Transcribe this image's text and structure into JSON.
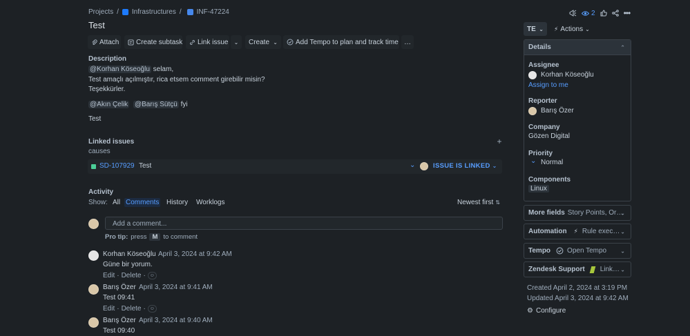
{
  "breadcrumb": {
    "projects": "Projects",
    "separator": "/",
    "project": "Infrastructures",
    "issue_key": "INF-47224"
  },
  "issue_title": "Test",
  "toolbar": {
    "attach": "Attach",
    "create_subtask": "Create subtask",
    "link_issue": "Link issue",
    "create": "Create",
    "tempo": "Add Tempo to plan and track time",
    "more": "…"
  },
  "top_right": {
    "watchers_count": "2"
  },
  "description": {
    "heading": "Description",
    "mention_1": "@Korhan Köseoğlu",
    "line1_rest": " selam,",
    "line2": "Test amaçlı açılmıştır, rica etsem comment girebilir misin?",
    "line3": "Teşekkürler.",
    "mention_2": "@Akın Çelik",
    "mention_3": "@Barış Sütçü",
    "fyi": " fyi",
    "line5": "Test"
  },
  "linked_issues": {
    "heading": "Linked issues",
    "relation": "causes",
    "item": {
      "key": "SD-107929",
      "summary": "Test",
      "status": "ISSUE IS LINKED"
    }
  },
  "activity": {
    "heading": "Activity",
    "show_label": "Show:",
    "tabs": [
      "All",
      "Comments",
      "History",
      "Worklogs"
    ],
    "sort": "Newest first",
    "comment_placeholder": "Add a comment...",
    "pro_tip_label": "Pro tip:",
    "pro_tip_press": "press",
    "pro_tip_key": "M",
    "pro_tip_rest": "to comment",
    "comments": [
      {
        "author": "Korhan Köseoğlu",
        "date": "April 3, 2024 at 9:42 AM",
        "body": "Güne bir yorum.",
        "edit": "Edit",
        "delete": "Delete"
      },
      {
        "author": "Barış Özer",
        "date": "April 3, 2024 at 9:41 AM",
        "body": "Test 09:41",
        "edit": "Edit",
        "delete": "Delete"
      },
      {
        "author": "Barış Özer",
        "date": "April 3, 2024 at 9:40 AM",
        "body": "Test 09:40"
      }
    ]
  },
  "sidebar": {
    "status": "TE",
    "actions": "Actions",
    "details_heading": "Details",
    "assignee_label": "Assignee",
    "assignee": "Korhan Köseoğlu",
    "assign_to_me": "Assign to me",
    "reporter_label": "Reporter",
    "reporter": "Barış Özer",
    "company_label": "Company",
    "company": "Gözen Digital",
    "priority_label": "Priority",
    "priority": "Normal",
    "components_label": "Components",
    "component": "Linux",
    "more_fields": "More fields",
    "more_fields_hint": "Story Points, Or…",
    "automation": "Automation",
    "automation_hint": "Rule exec…",
    "tempo": "Tempo",
    "tempo_hint": "Open Tempo",
    "zendesk": "Zendesk Support",
    "zendesk_hint": "Link…",
    "created": "Created April 2, 2024 at 3:19 PM",
    "updated": "Updated April 3, 2024 at 9:42 AM",
    "configure": "Configure"
  },
  "colors": {
    "background": "#1d2125",
    "link": "#579dff",
    "status_linked": "#579dff",
    "issue_type_green": "#4bce97"
  },
  "icons": [
    "project-icon",
    "task-icon",
    "paperclip-icon",
    "subtask-icon",
    "link-icon",
    "tempo-icon",
    "megaphone-icon",
    "eye-icon",
    "thumbs-up-icon",
    "share-icon",
    "more-icon",
    "lightning-icon",
    "plus-icon",
    "sort-icon",
    "emoji-icon",
    "gear-icon"
  ]
}
